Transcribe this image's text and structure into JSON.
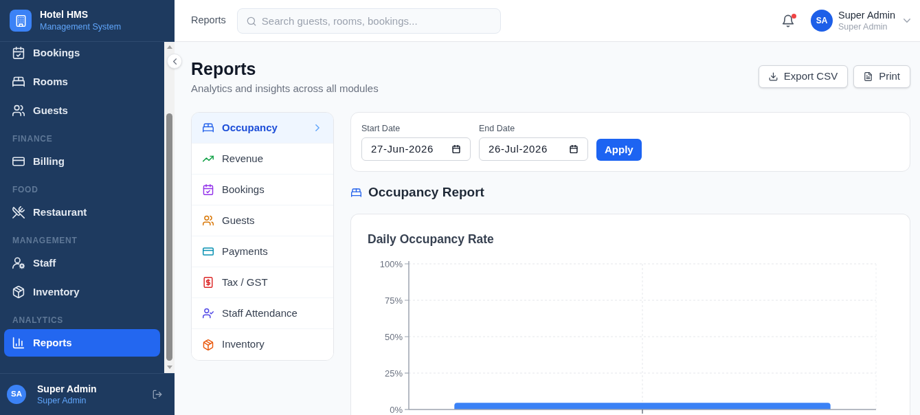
{
  "sidebar": {
    "brand": {
      "title": "Hotel HMS",
      "subtitle": "Management System"
    },
    "sections": [
      {
        "items": [
          {
            "label": "Bookings",
            "selected": false
          },
          {
            "label": "Rooms",
            "selected": false
          },
          {
            "label": "Guests",
            "selected": false
          }
        ]
      },
      {
        "heading": "FINANCE",
        "items": [
          {
            "label": "Billing",
            "selected": false
          }
        ]
      },
      {
        "heading": "FOOD",
        "items": [
          {
            "label": "Restaurant",
            "selected": false
          }
        ]
      },
      {
        "heading": "MANAGEMENT",
        "items": [
          {
            "label": "Staff",
            "selected": false
          },
          {
            "label": "Inventory",
            "selected": false
          }
        ]
      },
      {
        "heading": "ANALYTICS",
        "items": [
          {
            "label": "Reports",
            "selected": true
          }
        ]
      }
    ],
    "user": {
      "initials": "SA",
      "name": "Super Admin",
      "role": "Super Admin"
    }
  },
  "header": {
    "breadcrumb": "Reports",
    "search": {
      "placeholder": "Search guests, rooms, bookings..."
    },
    "notifications": {
      "unread": true
    },
    "user": {
      "initials": "SA",
      "name": "Super Admin",
      "role": "Super Admin"
    }
  },
  "page": {
    "title": "Reports",
    "subtitle": "Analytics and insights across all modules",
    "actions": [
      {
        "label": "Export CSV"
      },
      {
        "label": "Print"
      }
    ]
  },
  "report_types": [
    {
      "label": "Occupancy",
      "selected": true
    },
    {
      "label": "Revenue",
      "selected": false
    },
    {
      "label": "Bookings",
      "selected": false
    },
    {
      "label": "Guests",
      "selected": false
    },
    {
      "label": "Payments",
      "selected": false
    },
    {
      "label": "Tax / GST",
      "selected": false
    },
    {
      "label": "Staff Attendance",
      "selected": false
    },
    {
      "label": "Inventory",
      "selected": false
    }
  ],
  "filters": {
    "fields": [
      {
        "label": "Start Date",
        "value": "27-Jun-2026"
      },
      {
        "label": "End Date",
        "value": "26-Jul-2026"
      }
    ],
    "apply": "Apply"
  },
  "report": {
    "title": "Occupancy Report",
    "chart_card": {
      "chart_data": {
        "type": "bar",
        "title": "Daily Occupancy Rate",
        "values": [
          4.6
        ],
        "ylim": [
          0,
          100
        ],
        "yticks": [
          {
            "value": 0,
            "label": "0%"
          },
          {
            "value": 25,
            "label": "25%"
          },
          {
            "value": 50,
            "label": "50%"
          },
          {
            "value": 75,
            "label": "75%"
          },
          {
            "value": 100,
            "label": "100%"
          }
        ],
        "grid": true
      }
    }
  }
}
